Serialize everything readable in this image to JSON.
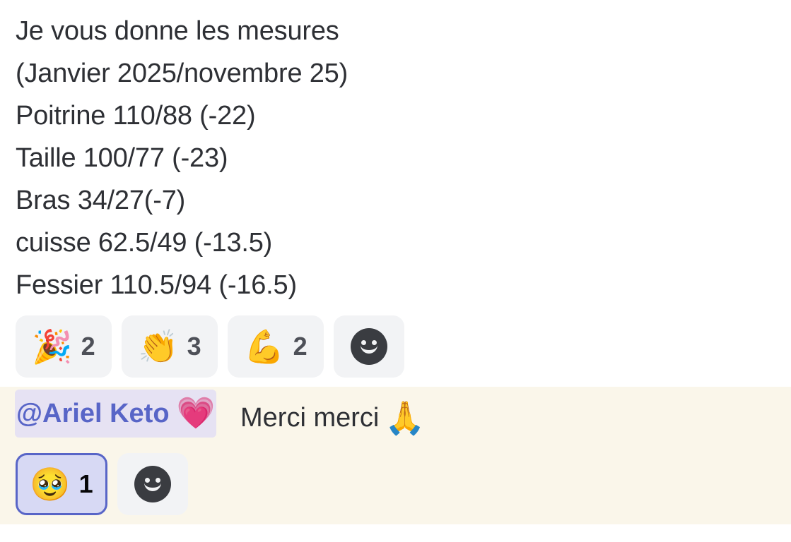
{
  "message_1": {
    "lines": [
      "Je vous donne les mesures",
      "(Janvier 2025/novembre 25)",
      "Poitrine 110/88 (-22)",
      "Taille 100/77 (-23)",
      "Bras 34/27(-7)",
      "cuisse 62.5/49 (-13.5)",
      "Fessier 110.5/94 (-16.5)"
    ],
    "reactions": [
      {
        "emoji": "🎉",
        "icon": "party-popper-emoji",
        "count": "2"
      },
      {
        "emoji": "👏",
        "icon": "clapping-hands-emoji",
        "count": "3"
      },
      {
        "emoji": "💪",
        "icon": "flexed-biceps-emoji",
        "count": "2"
      }
    ]
  },
  "message_2": {
    "mention": "@Ariel Keto",
    "mention_emoji": "💗",
    "text": "Merci merci",
    "text_emoji": "🙏",
    "reactions": [
      {
        "emoji": "🥹",
        "icon": "face-holding-back-tears-emoji",
        "count": "1",
        "active": true
      }
    ]
  },
  "colors": {
    "highlight_bg": "#faf6ea",
    "mention_color": "#5865c7",
    "reaction_bg": "#f2f3f5",
    "active_reaction_border": "#5865c7"
  }
}
